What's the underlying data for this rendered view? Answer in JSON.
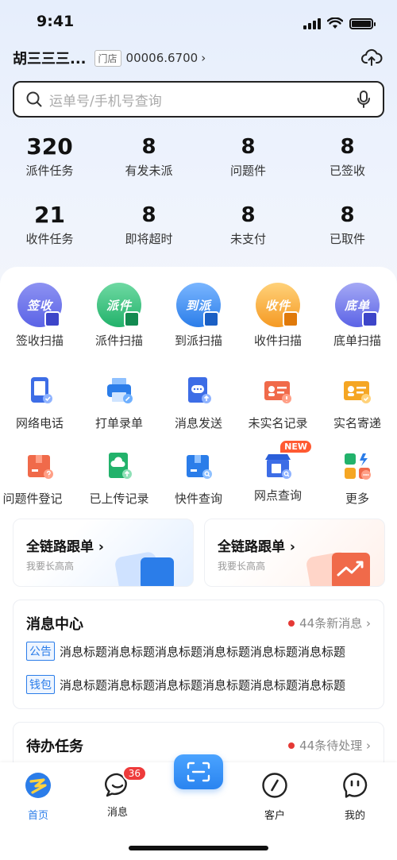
{
  "status": {
    "time": "9:41"
  },
  "store": {
    "name": "胡三三三...",
    "tag": "门店",
    "code": "00006.6700",
    "chevron": "›"
  },
  "search": {
    "placeholder": "运单号/手机号查询"
  },
  "stats": [
    {
      "value": "320",
      "label": "派件任务"
    },
    {
      "value": "8",
      "label": "有发未派"
    },
    {
      "value": "8",
      "label": "问题件"
    },
    {
      "value": "8",
      "label": "已签收"
    },
    {
      "value": "21",
      "label": "收件任务"
    },
    {
      "value": "8",
      "label": "即将超时"
    },
    {
      "value": "8",
      "label": "未支付"
    },
    {
      "value": "8",
      "label": "已取件"
    }
  ],
  "scan_actions": [
    {
      "icon_text": "签收",
      "label": "签收扫描",
      "icon": "sign-scan-icon",
      "color": "#5b63e6"
    },
    {
      "icon_text": "派件",
      "label": "派件扫描",
      "icon": "dispatch-scan-icon",
      "color": "#22b26b"
    },
    {
      "icon_text": "到派",
      "label": "到派扫描",
      "icon": "arrive-scan-icon",
      "color": "#2b7de9"
    },
    {
      "icon_text": "收件",
      "label": "收件扫描",
      "icon": "receive-scan-icon",
      "color": "#f59a23"
    },
    {
      "icon_text": "底单",
      "label": "底单扫描",
      "icon": "receipt-scan-icon",
      "color": "#5b63e6"
    }
  ],
  "tools_row1": [
    {
      "label": "网络电话",
      "icon": "phone-icon"
    },
    {
      "label": "打单录单",
      "icon": "printer-icon"
    },
    {
      "label": "消息发送",
      "icon": "message-send-icon"
    },
    {
      "label": "未实名记录",
      "icon": "unverified-id-icon"
    },
    {
      "label": "实名寄递",
      "icon": "verified-id-icon"
    }
  ],
  "tools_row2": [
    {
      "label": "问题件登记",
      "icon": "problem-package-icon"
    },
    {
      "label": "已上传记录",
      "icon": "upload-record-icon"
    },
    {
      "label": "快件查询",
      "icon": "package-search-icon"
    },
    {
      "label": "网点查询",
      "icon": "outlet-search-icon",
      "badge": "NEW"
    },
    {
      "label": "更多",
      "icon": "more-apps-icon"
    }
  ],
  "promos": [
    {
      "title": "全链路跟单 ›",
      "subtitle": "我要长高高"
    },
    {
      "title": "全链路跟单 ›",
      "subtitle": "我要长高高"
    }
  ],
  "messages": {
    "title": "消息中心",
    "count_text": "44条新消息 ›",
    "items": [
      {
        "tag": "公告",
        "text": "消息标题消息标题消息标题消息标题消息标题消息标题"
      },
      {
        "tag": "钱包",
        "text": "消息标题消息标题消息标题消息标题消息标题消息标题"
      }
    ]
  },
  "todo": {
    "title": "待办任务",
    "count_text": "44条待处理 ›"
  },
  "tabs": [
    {
      "label": "首页",
      "icon": "home-logo-icon"
    },
    {
      "label": "消息",
      "icon": "chat-bubble-icon",
      "badge": "36"
    },
    {
      "label": "客户",
      "icon": "compass-icon"
    },
    {
      "label": "我的",
      "icon": "profile-face-icon"
    }
  ],
  "colors": {
    "accent": "#2b7de9",
    "alert": "#e53935",
    "new_badge": "#ff5a32"
  }
}
